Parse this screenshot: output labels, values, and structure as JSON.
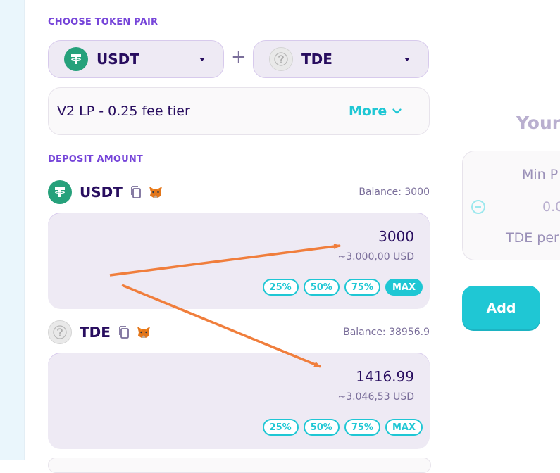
{
  "choose_pair": {
    "label": "CHOOSE TOKEN PAIR",
    "token_a": {
      "symbol": "USDT",
      "icon": "tether-icon"
    },
    "separator": "+",
    "token_b": {
      "symbol": "TDE",
      "icon": "tde-token-icon"
    }
  },
  "fee": {
    "text": "V2 LP - 0.25 fee tier",
    "more_label": "More"
  },
  "deposit": {
    "label": "DEPOSIT AMOUNT",
    "token_a": {
      "symbol": "USDT",
      "balance": "Balance: 3000",
      "amount": "3000",
      "usd": "~3.000,00 USD",
      "percent_buttons": [
        "25%",
        "50%",
        "75%",
        "MAX"
      ],
      "active_button": "MAX"
    },
    "token_b": {
      "symbol": "TDE",
      "balance": "Balance: 38956.9",
      "amount": "1416.99",
      "usd": "~3.046,53 USD",
      "percent_buttons": [
        "25%",
        "50%",
        "75%",
        "MAX"
      ]
    }
  },
  "right_panel": {
    "heading": "Your",
    "min_price_label": "Min P",
    "min_price_value": "0.0",
    "per_label": "TDE per",
    "add_button": "Add"
  },
  "colors": {
    "accent": "#1fc7d4",
    "section_label": "#7645d9",
    "text_primary": "#280d5f",
    "annotation_arrow": "#f07e3c"
  }
}
